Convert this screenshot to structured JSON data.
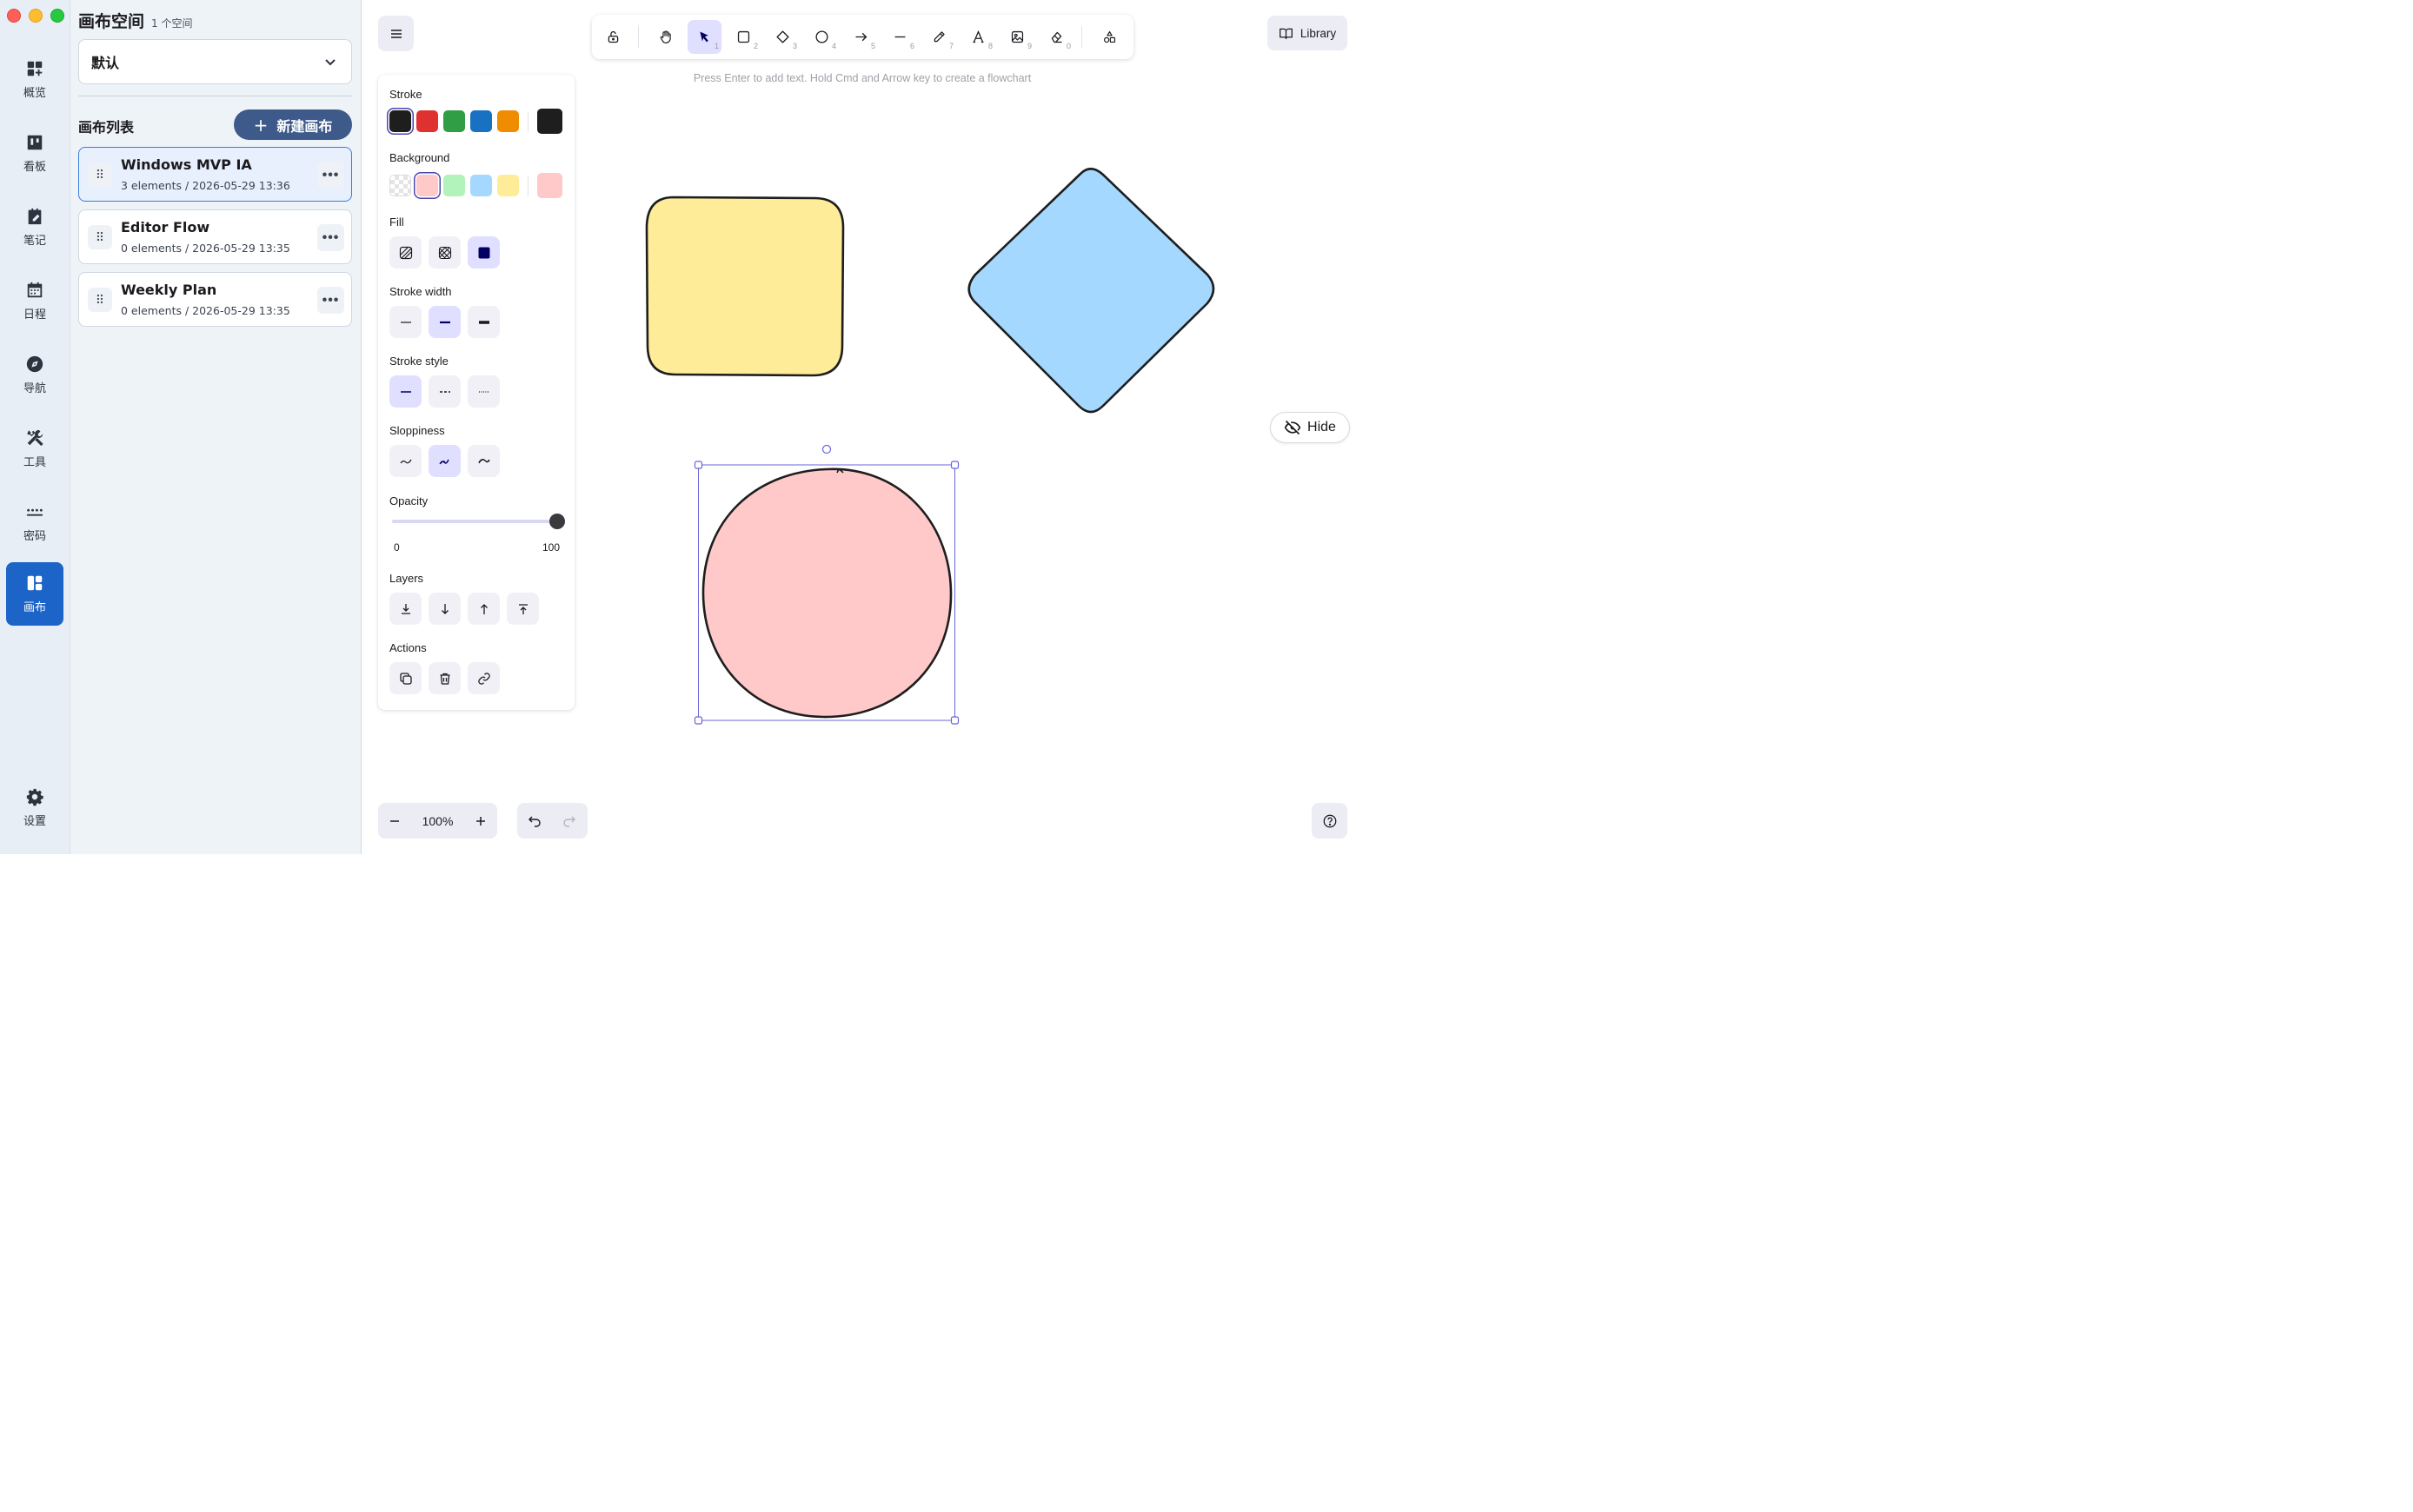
{
  "rail": {
    "items": [
      {
        "label": "概览",
        "icon": "dashboard-icon"
      },
      {
        "label": "看板",
        "icon": "kanban-icon"
      },
      {
        "label": "笔记",
        "icon": "notes-icon"
      },
      {
        "label": "日程",
        "icon": "calendar-icon"
      },
      {
        "label": "导航",
        "icon": "compass-icon"
      },
      {
        "label": "工具",
        "icon": "tools-icon"
      },
      {
        "label": "密码",
        "icon": "password-icon"
      },
      {
        "label": "画布",
        "icon": "canvas-icon"
      }
    ],
    "active": "画布",
    "settings_label": "设置"
  },
  "list_panel": {
    "title": "画布空间",
    "space_count": "1 个空间",
    "space_selected": "默认",
    "section_title": "画布列表",
    "new_button": "新建画布",
    "canvases": [
      {
        "name": "Windows MVP IA",
        "meta": "3 elements / 2026-05-29 13:36",
        "selected": true
      },
      {
        "name": "Editor Flow",
        "meta": "0 elements / 2026-05-29 13:35",
        "selected": false
      },
      {
        "name": "Weekly Plan",
        "meta": "0 elements / 2026-05-29 13:35",
        "selected": false
      }
    ]
  },
  "toolbar": {
    "tools": [
      {
        "name": "lock",
        "key": ""
      },
      {
        "name": "hand",
        "key": ""
      },
      {
        "name": "selection",
        "key": "1",
        "active": true
      },
      {
        "name": "rectangle",
        "key": "2"
      },
      {
        "name": "diamond",
        "key": "3"
      },
      {
        "name": "ellipse",
        "key": "4"
      },
      {
        "name": "arrow",
        "key": "5"
      },
      {
        "name": "line",
        "key": "6"
      },
      {
        "name": "draw",
        "key": "7"
      },
      {
        "name": "text",
        "key": "8"
      },
      {
        "name": "image",
        "key": "9"
      },
      {
        "name": "eraser",
        "key": "0"
      },
      {
        "name": "extra-tools",
        "key": ""
      }
    ],
    "hint": "Press Enter to add text. Hold Cmd and Arrow key to create a flowchart",
    "library_label": "Library"
  },
  "properties": {
    "stroke_label": "Stroke",
    "stroke_colors": [
      "#1e1e1e",
      "#e03131",
      "#2f9e44",
      "#1971c2",
      "#f08c00"
    ],
    "stroke_current": "#1e1e1e",
    "background_label": "Background",
    "background_colors": [
      "transparent",
      "#ffc9c9",
      "#b2f2bb",
      "#a5d8ff",
      "#ffec99"
    ],
    "background_current": "#ffc9c9",
    "fill_label": "Fill",
    "stroke_width_label": "Stroke width",
    "stroke_style_label": "Stroke style",
    "sloppiness_label": "Sloppiness",
    "opacity_label": "Opacity",
    "opacity_min": "0",
    "opacity_max": "100",
    "opacity_value": 100,
    "layers_label": "Layers",
    "actions_label": "Actions"
  },
  "canvas": {
    "hide_label": "Hide",
    "zoom": "100%",
    "shapes": [
      {
        "type": "rectangle",
        "fill": "#ffec99",
        "stroke": "#1e1e1e"
      },
      {
        "type": "diamond",
        "fill": "#a5d8ff",
        "stroke": "#1e1e1e"
      },
      {
        "type": "ellipse",
        "fill": "#ffc9c9",
        "stroke": "#1e1e1e",
        "selected": true
      }
    ]
  },
  "colors": {
    "accent": "#1d64c8",
    "selection": "#6965db",
    "new_button": "#3e5a8a"
  }
}
